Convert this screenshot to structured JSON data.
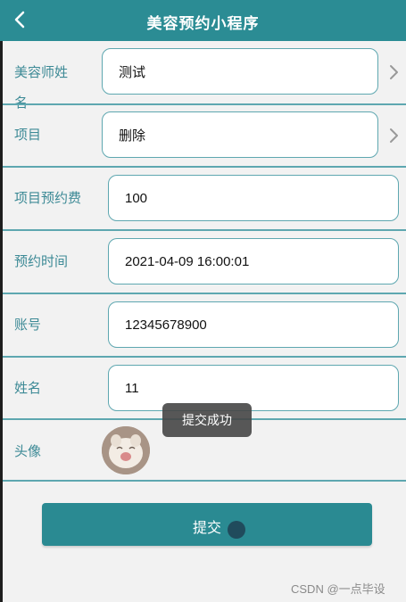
{
  "header": {
    "title": "美容预约小程序"
  },
  "form": {
    "beautician": {
      "label_line1": "美容师姓",
      "label_line2": "名",
      "value": "测试"
    },
    "project": {
      "label": "项目",
      "value": "删除"
    },
    "fee": {
      "label": "项目预约费",
      "value": "100"
    },
    "time": {
      "label": "预约时间",
      "value": "2021-04-09 16:00:01"
    },
    "account": {
      "label": "账号",
      "value": "12345678900"
    },
    "name": {
      "label": "姓名",
      "value": "11"
    },
    "avatar": {
      "label": "头像"
    }
  },
  "toast": {
    "text": "提交成功"
  },
  "submit": {
    "label": "提交"
  },
  "watermark": {
    "text": "CSDN @一点毕设"
  },
  "colors": {
    "primary": "#2b8c94",
    "border": "#5ea7b0",
    "label": "#3d8a96"
  }
}
